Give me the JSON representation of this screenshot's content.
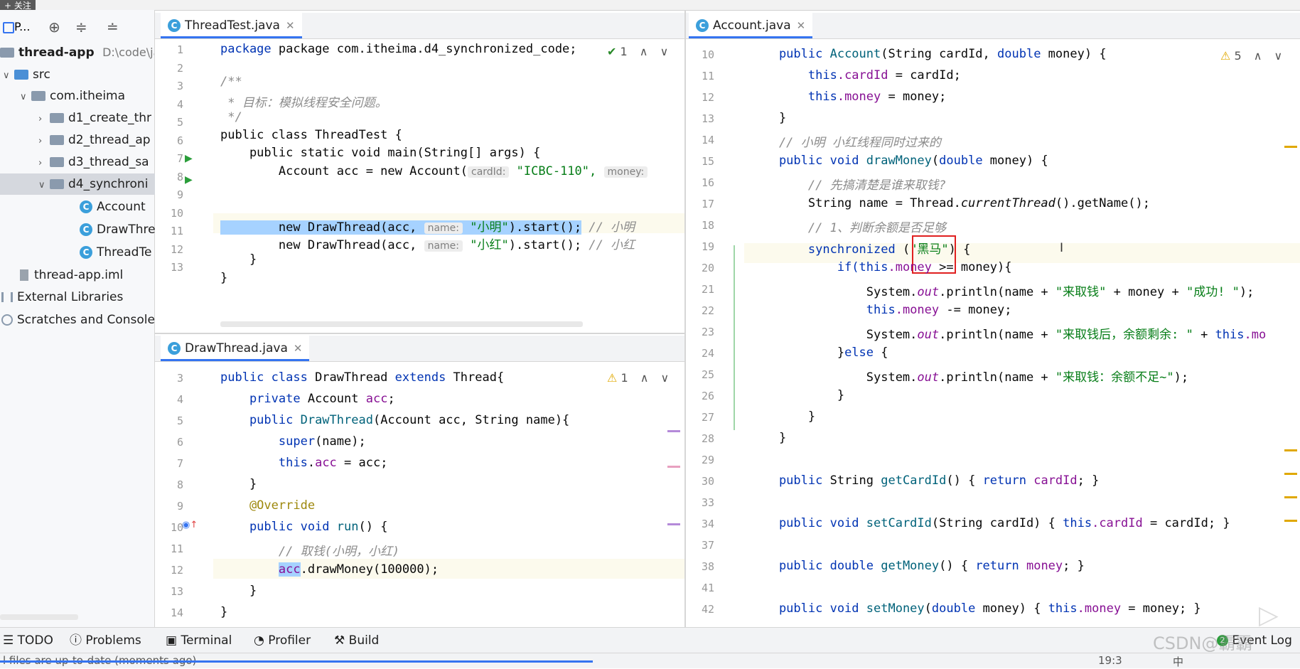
{
  "top": {
    "follow": "+ 关注"
  },
  "project": {
    "title": "P...",
    "root": {
      "name": "thread-app",
      "path": "D:\\code\\jav"
    },
    "items": [
      {
        "label": "src"
      },
      {
        "label": "com.itheima"
      },
      {
        "label": "d1_create_thr"
      },
      {
        "label": "d2_thread_ap"
      },
      {
        "label": "d3_thread_sa"
      },
      {
        "label": "d4_synchroni"
      },
      {
        "label": "Account"
      },
      {
        "label": "DrawThre"
      },
      {
        "label": "ThreadTe"
      },
      {
        "label": "thread-app.iml"
      },
      {
        "label": "External Libraries"
      },
      {
        "label": "Scratches and Consoles"
      }
    ]
  },
  "pane1": {
    "tab": "ThreadTest.java",
    "inspection": "1",
    "lines": [
      {
        "n": "1",
        "code": "package com.itheima.d4_synchronized_code;"
      },
      {
        "n": "2",
        "code": ""
      },
      {
        "n": "3",
        "code": "/**"
      },
      {
        "n": "4",
        "code": " * 目标：模拟线程安全问题。"
      },
      {
        "n": "5",
        "code": " */"
      },
      {
        "n": "6",
        "code": "public class ThreadTest {"
      },
      {
        "n": "7",
        "code": "    public static void main(String[] args) {"
      },
      {
        "n": "8",
        "code": "        Account acc = new Account("
      },
      {
        "n": "9",
        "code": "        new DrawThread(acc, "
      },
      {
        "n": "10",
        "code": "        new DrawThread(acc, "
      },
      {
        "n": "11",
        "code": "    }"
      },
      {
        "n": "12",
        "code": "}"
      },
      {
        "n": "13",
        "code": ""
      }
    ],
    "hint_cardid": "cardId:",
    "val_icbc": "\"ICBC-110\",",
    "hint_money": "money:",
    "hint_name": "name:",
    "str_xiaoming": "\"小明\"",
    "tail9": ").start();",
    "cm_xiaoming": "// 小明",
    "str_xiaohong": "\"小红\"",
    "tail10": ").start(); ",
    "cm_xiaohong": "// 小红"
  },
  "pane2": {
    "tab": "DrawThread.java",
    "warnings": "1",
    "lines": [
      {
        "n": "3"
      },
      {
        "n": "4"
      },
      {
        "n": "5"
      },
      {
        "n": "6"
      },
      {
        "n": "7"
      },
      {
        "n": "8"
      },
      {
        "n": "9"
      },
      {
        "n": "10"
      },
      {
        "n": "11"
      },
      {
        "n": "12"
      },
      {
        "n": "13"
      },
      {
        "n": "14"
      }
    ],
    "c3a": "public class ",
    "c3b": "DrawThread ",
    "c3c": "extends ",
    "c3d": "Thread{",
    "c4a": "    private ",
    "c4b": "Account ",
    "c4c": "acc",
    "c4d": ";",
    "c5a": "    public ",
    "c5b": "DrawThread",
    "c5c": "(Account acc, String name){",
    "c6a": "        super",
    "c6b": "(name);",
    "c7a": "        this",
    "c7b": ".",
    "c7c": "acc",
    "c7d": " = acc;",
    "c8": "    }",
    "c9": "    @Override",
    "c10a": "    public void ",
    "c10b": "run",
    "c10c": "() {",
    "c11": "        // 取钱(小明，小红)",
    "c12a": "        ",
    "c12b": "acc",
    "c12c": ".drawMoney(100000);",
    "c13": "    }",
    "c14": "}"
  },
  "pane3": {
    "tab": "Account.java",
    "warnings": "5",
    "lines": [
      {
        "n": "10"
      },
      {
        "n": "11"
      },
      {
        "n": "12"
      },
      {
        "n": "13"
      },
      {
        "n": "14"
      },
      {
        "n": "15"
      },
      {
        "n": "16"
      },
      {
        "n": "17"
      },
      {
        "n": "18"
      },
      {
        "n": "19"
      },
      {
        "n": "20"
      },
      {
        "n": "21"
      },
      {
        "n": "22"
      },
      {
        "n": "23"
      },
      {
        "n": "24"
      },
      {
        "n": "25"
      },
      {
        "n": "26"
      },
      {
        "n": "27"
      },
      {
        "n": "28"
      },
      {
        "n": "29"
      },
      {
        "n": "30"
      },
      {
        "n": "33"
      },
      {
        "n": "34"
      },
      {
        "n": "37"
      },
      {
        "n": "38"
      },
      {
        "n": "41"
      },
      {
        "n": "42"
      }
    ],
    "l10a": "    public ",
    "l10b": "Account",
    "l10c": "(String cardId, ",
    "l10d": "double",
    "l10e": " money) {",
    "l11a": "        this",
    "l11b": ".cardId",
    "l11c": " = cardId;",
    "l12a": "        this",
    "l12b": ".money",
    "l12c": " = money;",
    "l13": "    }",
    "l14": "    // 小明 小红线程同时过来的",
    "l15a": "    public void ",
    "l15b": "drawMoney",
    "l15c": "(",
    "l15d": "double",
    "l15e": " money) {",
    "l16": "        // 先搞清楚是谁来取钱?",
    "l17a": "        String name = Thread.",
    "l17b": "currentThread",
    "l17c": "().getName();",
    "l18": "        // 1、判断余额是否足够",
    "l19a": "        synchronized ",
    "l19b": "(",
    "l19c": "\"黑马\"",
    "l19d": ") {",
    "l20a": "            if(",
    "l20b": "this",
    "l20c": ".money",
    "l20d": " >= money){",
    "l21a": "                System.",
    "l21b": "out",
    "l21c": ".println(name + ",
    "l21d": "\"来取钱\"",
    "l21e": " + money + ",
    "l21f": "\"成功! \"",
    "l21g": ");",
    "l22a": "                ",
    "l22b": "this",
    "l22c": ".money",
    "l22d": " -= money;",
    "l23a": "                System.",
    "l23b": "out",
    "l23c": ".println(name + ",
    "l23d": "\"来取钱后，余额剩余: \"",
    "l23e": " + ",
    "l23f": "this",
    "l23g": ".mo",
    "l24a": "            }",
    "l24b": "else",
    "l24c": " {",
    "l25a": "                System.",
    "l25b": "out",
    "l25c": ".println(name + ",
    "l25d": "\"来取钱：余额不足~\"",
    "l25e": ");",
    "l26": "            }",
    "l27": "        }",
    "l28": "    }",
    "l30a": "    public ",
    "l30b": "String ",
    "l30c": "getCardId",
    "l30d": "() { ",
    "l30e": "return ",
    "l30f": "cardId",
    "l30g": "; }",
    "l34a": "    public void ",
    "l34b": "setCardId",
    "l34c": "(String cardId) { ",
    "l34d": "this",
    "l34e": ".cardId",
    "l34f": " = cardId; }",
    "l38a": "    public double ",
    "l38b": "getMoney",
    "l38c": "() { ",
    "l38d": "return ",
    "l38e": "money",
    "l38f": "; }",
    "l42a": "    public void ",
    "l42b": "setMoney",
    "l42c": "(",
    "l42d": "double",
    "l42e": " money) { ",
    "l42f": "this",
    "l42g": ".money",
    "l42h": " = money; }"
  },
  "toolwindows": {
    "todo": "TODO",
    "problems": "Problems",
    "terminal": "Terminal",
    "profiler": "Profiler",
    "build": "Build",
    "event_log": "Event Log",
    "event_count": "2"
  },
  "status": {
    "message": "l files are up-to-date (moments ago)",
    "time": "19:3",
    "ime": "中",
    "watermark": "CSDN@霸霸"
  },
  "colors": {
    "accent": "#3574f0",
    "keyword": "#0033b3",
    "string": "#067d17",
    "field": "#871094",
    "comment": "#8c8c8c",
    "annotation": "#9e880d",
    "highlight_box": "#e02020"
  }
}
